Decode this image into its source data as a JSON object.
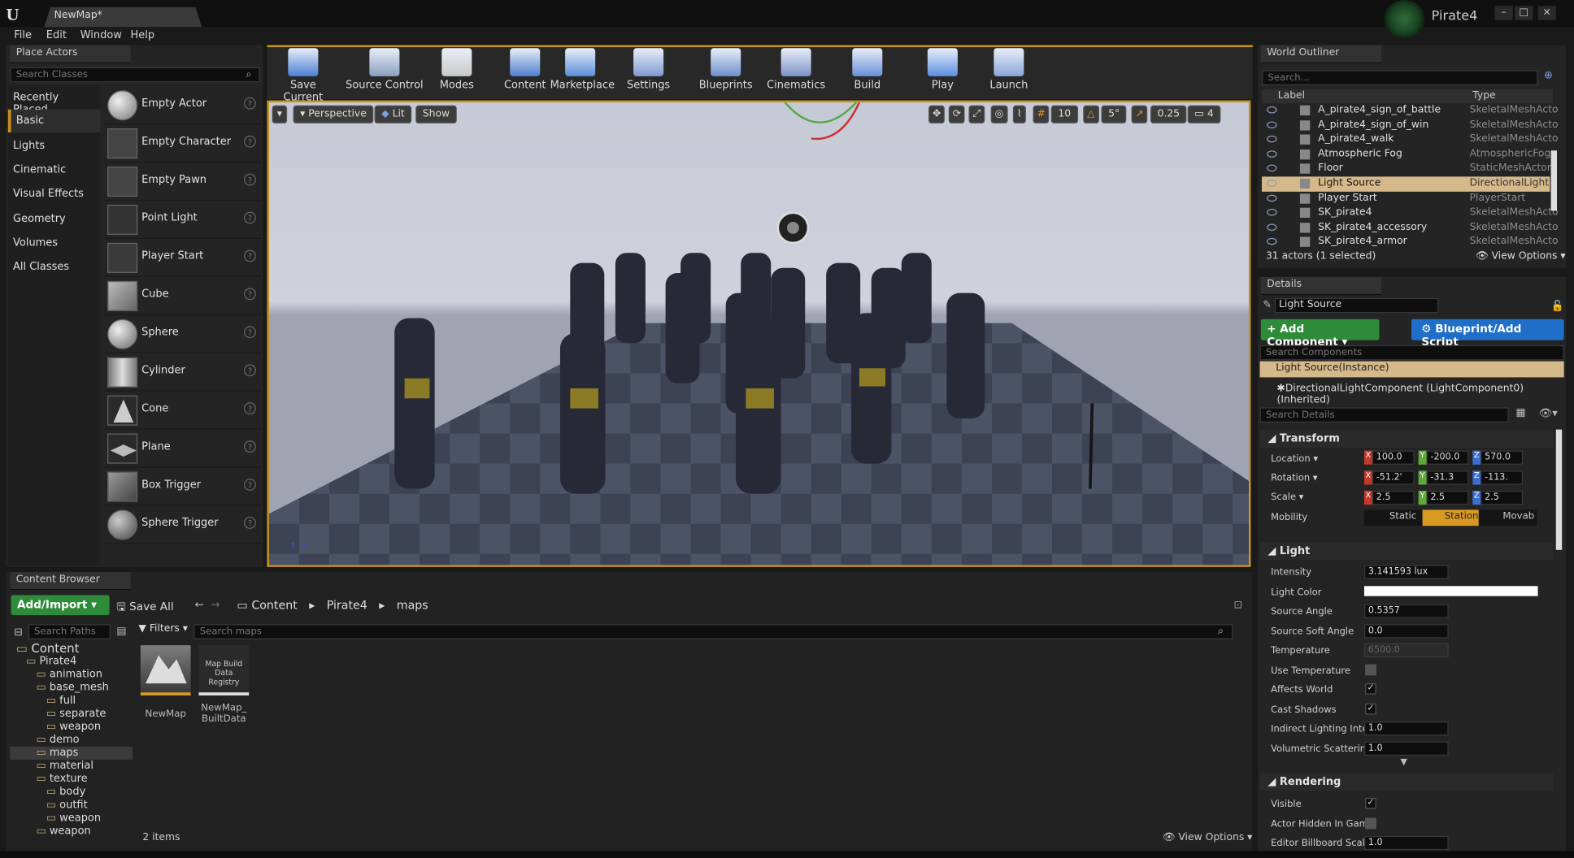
{
  "window": {
    "tab_title": "NewMap*",
    "project": "Pirate4"
  },
  "menu": [
    "File",
    "Edit",
    "Window",
    "Help"
  ],
  "place_actors": {
    "tab": "Place Actors",
    "search_placeholder": "Search Classes",
    "categories": [
      "Recently Placed",
      "Basic",
      "Lights",
      "Cinematic",
      "Visual Effects",
      "Geometry",
      "Volumes",
      "All Classes"
    ],
    "selected_category": "Basic",
    "actors": [
      "Empty Actor",
      "Empty Character",
      "Empty Pawn",
      "Point Light",
      "Player Start",
      "Cube",
      "Sphere",
      "Cylinder",
      "Cone",
      "Plane",
      "Box Trigger",
      "Sphere Trigger"
    ]
  },
  "toolbar": {
    "items": [
      {
        "label": "Save Current",
        "icon": "save-icon",
        "color": "#4a7fd4"
      },
      {
        "label": "Source Control",
        "icon": "source-control-icon",
        "color": "#8aa0c0"
      },
      {
        "label": "Modes",
        "icon": "modes-icon",
        "color": "#c9c9c9"
      },
      {
        "label": "Content",
        "icon": "content-icon",
        "color": "#4f7fcf"
      },
      {
        "label": "Marketplace",
        "icon": "marketplace-icon",
        "color": "#5b8fd8"
      },
      {
        "label": "Settings",
        "icon": "settings-icon",
        "color": "#7f9ad0"
      },
      {
        "label": "Blueprints",
        "icon": "blueprints-icon",
        "color": "#6d8fcc"
      },
      {
        "label": "Cinematics",
        "icon": "cinematics-icon",
        "color": "#7d93c7"
      },
      {
        "label": "Build",
        "icon": "build-icon",
        "color": "#6a8fd8"
      },
      {
        "label": "Play",
        "icon": "play-icon",
        "color": "#5b8fe0"
      },
      {
        "label": "Launch",
        "icon": "launch-icon",
        "color": "#8aa6d8"
      }
    ]
  },
  "viewport": {
    "perspective": "Perspective",
    "lit": "Lit",
    "show": "Show",
    "grid_snap": "10",
    "rot_snap": "5°",
    "scale_snap": "0.25",
    "cam_speed": "4"
  },
  "content_browser": {
    "tab": "Content Browser",
    "add_import": "Add/Import",
    "save_all": "Save All",
    "breadcrumb": [
      "Content",
      "Pirate4",
      "maps"
    ],
    "search_paths_placeholder": "Search Paths",
    "filters": "Filters",
    "search_placeholder": "Search maps",
    "tree": [
      {
        "label": "Content",
        "depth": 0
      },
      {
        "label": "Pirate4",
        "depth": 1
      },
      {
        "label": "animation",
        "depth": 2
      },
      {
        "label": "base_mesh",
        "depth": 2
      },
      {
        "label": "full",
        "depth": 3
      },
      {
        "label": "separate",
        "depth": 3
      },
      {
        "label": "weapon",
        "depth": 3
      },
      {
        "label": "demo",
        "depth": 2
      },
      {
        "label": "maps",
        "depth": 2
      },
      {
        "label": "material",
        "depth": 2
      },
      {
        "label": "texture",
        "depth": 2
      },
      {
        "label": "body",
        "depth": 3
      },
      {
        "label": "outfit",
        "depth": 3
      },
      {
        "label": "weapon",
        "depth": 3
      },
      {
        "label": "weapon",
        "depth": 2
      }
    ],
    "selected_folder": "maps",
    "assets": [
      {
        "name": "NewMap",
        "thumb_text": ""
      },
      {
        "name": "NewMap_ BuiltData",
        "thumb_text": "Map Build Data Registry"
      }
    ],
    "count": "2 items",
    "view_options": "View Options"
  },
  "outliner": {
    "tab": "World Outliner",
    "search_placeholder": "Search...",
    "col_label": "Label",
    "col_type": "Type",
    "rows": [
      {
        "label": "A_pirate4_sign_of_battle",
        "type": "SkeletalMeshActo"
      },
      {
        "label": "A_pirate4_sign_of_win",
        "type": "SkeletalMeshActo"
      },
      {
        "label": "A_pirate4_walk",
        "type": "SkeletalMeshActo"
      },
      {
        "label": "Atmospheric Fog",
        "type": "AtmosphericFog"
      },
      {
        "label": "Floor",
        "type": "StaticMeshActor"
      },
      {
        "label": "Light Source",
        "type": "DirectionalLight"
      },
      {
        "label": "Player Start",
        "type": "PlayerStart"
      },
      {
        "label": "SK_pirate4",
        "type": "SkeletalMeshActo"
      },
      {
        "label": "SK_pirate4_accessory",
        "type": "SkeletalMeshActo"
      },
      {
        "label": "SK_pirate4_armor",
        "type": "SkeletalMeshActo"
      }
    ],
    "selected": "Light Source",
    "status": "31 actors (1 selected)",
    "view_options": "View Options"
  },
  "details": {
    "tab": "Details",
    "name": "Light Source",
    "add_component": "+ Add Component",
    "blueprint": "Blueprint/Add Script",
    "search_components": "Search Components",
    "instance": "Light Source(Instance)",
    "component": "DirectionalLightComponent (LightComponent0) (Inherited)",
    "search_details": "Search Details",
    "transform": {
      "title": "Transform",
      "location_label": "Location",
      "location": [
        "100.0",
        "-200.0",
        "570.0"
      ],
      "rotation_label": "Rotation",
      "rotation": [
        "-51.2'",
        "-31.3",
        "-113."
      ],
      "scale_label": "Scale",
      "scale": [
        "2.5",
        "2.5",
        "2.5"
      ],
      "mobility_label": "Mobility",
      "mobility": [
        "Static",
        "Station",
        "Movab"
      ],
      "mobility_selected": "Station"
    },
    "light": {
      "title": "Light",
      "props": [
        {
          "label": "Intensity",
          "value": "3.141593 lux",
          "kind": "field"
        },
        {
          "label": "Light Color",
          "value": "",
          "kind": "color"
        },
        {
          "label": "Source Angle",
          "value": "0.5357",
          "kind": "field"
        },
        {
          "label": "Source Soft Angle",
          "value": "0.0",
          "kind": "field"
        },
        {
          "label": "Temperature",
          "value": "6500.0",
          "kind": "disabled"
        },
        {
          "label": "Use Temperature",
          "value": "",
          "kind": "check-off"
        },
        {
          "label": "Affects World",
          "value": "✓",
          "kind": "check-on"
        },
        {
          "label": "Cast Shadows",
          "value": "✓",
          "kind": "check-on"
        },
        {
          "label": "Indirect Lighting Intens",
          "value": "1.0",
          "kind": "field"
        },
        {
          "label": "Volumetric Scattering",
          "value": "1.0",
          "kind": "field"
        }
      ]
    },
    "rendering": {
      "title": "Rendering",
      "props": [
        {
          "label": "Visible",
          "value": "✓",
          "kind": "check-on"
        },
        {
          "label": "Actor Hidden In Game",
          "value": "",
          "kind": "check-off"
        },
        {
          "label": "Editor Billboard Scale",
          "value": "1.0",
          "kind": "field"
        }
      ]
    }
  },
  "colors": {
    "accent": "#c8961e",
    "add_green": "#2e8b3a",
    "blueprint_blue": "#1f6ec8",
    "selected_row": "#d6b98a"
  }
}
